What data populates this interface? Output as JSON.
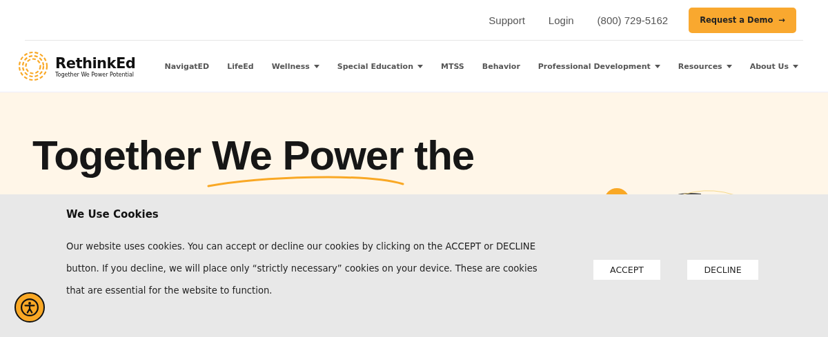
{
  "top_links": [
    "Support",
    "Login",
    "(800) 729-5162"
  ],
  "demo_button": {
    "label": "Request a Demo",
    "arrow": "→"
  },
  "logo": {
    "name": "RethinkEd",
    "tagline": "Together We Power Potential"
  },
  "nav": [
    {
      "label": "NavigatED",
      "dropdown": false
    },
    {
      "label": "LifeEd",
      "dropdown": false
    },
    {
      "label": "Wellness",
      "dropdown": true
    },
    {
      "label": "Special Education",
      "dropdown": true
    },
    {
      "label": "MTSS",
      "dropdown": false
    },
    {
      "label": "Behavior",
      "dropdown": false
    },
    {
      "label": "Professional Development",
      "dropdown": true
    },
    {
      "label": "Resources",
      "dropdown": true
    },
    {
      "label": "About Us",
      "dropdown": true
    }
  ],
  "hero": {
    "heading_before": "Together ",
    "heading_underlined": "We Power",
    "heading_after": " the"
  },
  "cookie_banner": {
    "title": "We Use Cookies",
    "text": "Our website uses cookies. You can accept or decline our cookies by clicking on the ACCEPT or DECLINE button. If you decline, we will place only “strictly necessary” cookies on your device. These are cookies that are essential for the website to function.",
    "buttons": [
      "ACCEPT",
      "DECLINE"
    ]
  }
}
